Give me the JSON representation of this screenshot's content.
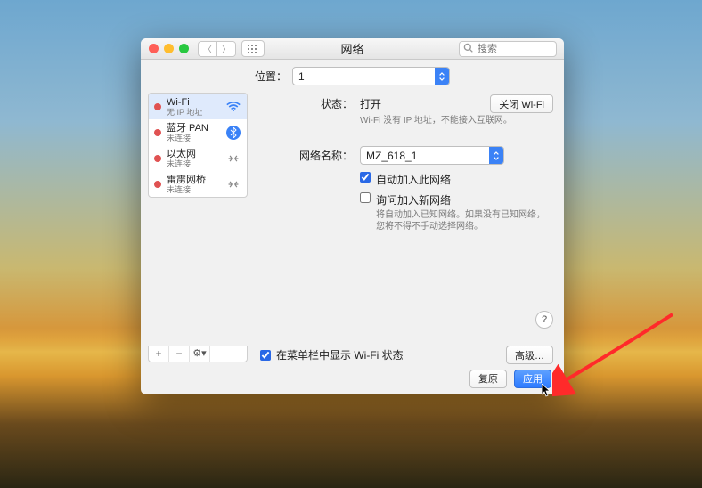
{
  "window": {
    "title": "网络",
    "search_placeholder": "搜索"
  },
  "location": {
    "label": "位置：",
    "value": "1"
  },
  "sidebar": {
    "items": [
      {
        "name": "Wi-Fi",
        "sub": "无 IP 地址",
        "icon": "wifi",
        "selected": true
      },
      {
        "name": "蓝牙 PAN",
        "sub": "未连接",
        "icon": "bluetooth",
        "selected": false
      },
      {
        "name": "以太网",
        "sub": "未连接",
        "icon": "ethernet",
        "selected": false
      },
      {
        "name": "雷雳网桥",
        "sub": "未连接",
        "icon": "bridge",
        "selected": false
      }
    ],
    "add": "+",
    "remove": "−",
    "gear": "⚙︎▾"
  },
  "panel": {
    "status_label": "状态：",
    "status_value": "打开",
    "turn_off_btn": "关闭 Wi-Fi",
    "status_note": "Wi-Fi 没有 IP 地址，不能接入互联网。",
    "network_name_label": "网络名称：",
    "network_name_value": "MZ_618_1",
    "auto_join_label": "自动加入此网络",
    "ask_join_label": "询问加入新网络",
    "ask_join_note": "将自动加入已知网络。如果没有已知网络，您将不得不手动选择网络。",
    "show_status_label": "在菜单栏中显示 Wi-Fi 状态",
    "advanced_btn": "高级…",
    "help": "?"
  },
  "footer": {
    "revert": "复原",
    "apply": "应用"
  }
}
